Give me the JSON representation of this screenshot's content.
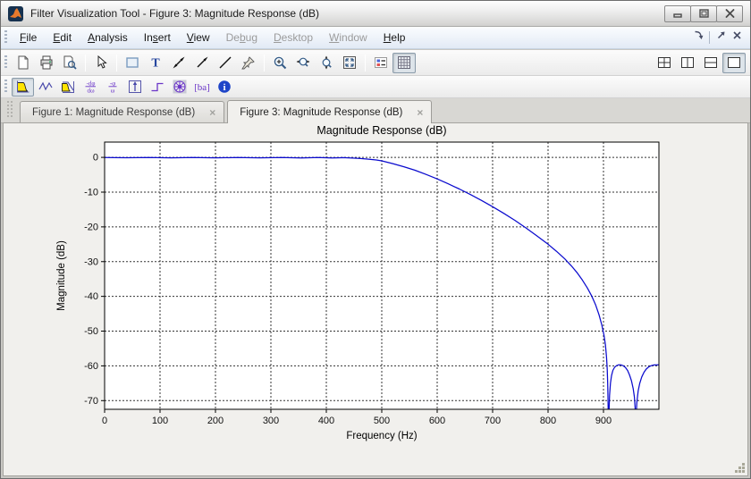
{
  "window": {
    "title": "Filter Visualization Tool - Figure 3: Magnitude Response (dB)",
    "controls": [
      {
        "name": "minimize-button",
        "icon": "minimize-icon"
      },
      {
        "name": "maximize-button",
        "icon": "maximize-icon"
      },
      {
        "name": "close-button",
        "icon": "close-icon"
      }
    ]
  },
  "menu_bar": {
    "items": [
      {
        "label": "File",
        "underline": 0,
        "enabled": true
      },
      {
        "label": "Edit",
        "underline": 0,
        "enabled": true
      },
      {
        "label": "Analysis",
        "underline": 0,
        "enabled": true
      },
      {
        "label": "Insert",
        "underline": 2,
        "enabled": true
      },
      {
        "label": "View",
        "underline": 0,
        "enabled": true
      },
      {
        "label": "Debug",
        "underline": 2,
        "enabled": false
      },
      {
        "label": "Desktop",
        "underline": 0,
        "enabled": false
      },
      {
        "label": "Window",
        "underline": 0,
        "enabled": false
      },
      {
        "label": "Help",
        "underline": 0,
        "enabled": true
      }
    ],
    "right_buttons": [
      {
        "name": "dock-figure-button",
        "icon": "dock-curved-arrow-icon"
      },
      {
        "name": "undock-figure-button",
        "icon": "undock-arrow-icon",
        "sep_before": true
      },
      {
        "name": "close-figure-button",
        "icon": "close-x-icon"
      }
    ]
  },
  "toolbar_main": {
    "left_buttons": [
      {
        "name": "new-session-button",
        "icon": "new-document-icon"
      },
      {
        "name": "print-button",
        "icon": "print-icon"
      },
      {
        "name": "print-preview-button",
        "icon": "print-preview-icon"
      },
      {
        "name": "edit-plot-button",
        "icon": "pointer-icon",
        "sep_before": true
      },
      {
        "name": "insert-rectangle-button",
        "icon": "rectangle-icon",
        "sep_before": true
      },
      {
        "name": "insert-text-button",
        "icon": "text-icon"
      },
      {
        "name": "insert-double-arrow-button",
        "icon": "double-arrow-icon"
      },
      {
        "name": "insert-arrow-button",
        "icon": "arrow-icon"
      },
      {
        "name": "insert-line-button",
        "icon": "line-icon"
      },
      {
        "name": "pin-to-axes-button",
        "icon": "pin-icon"
      },
      {
        "name": "zoom-in-button",
        "icon": "zoom-in-icon",
        "sep_before": true
      },
      {
        "name": "zoom-x-button",
        "icon": "zoom-x-icon"
      },
      {
        "name": "zoom-y-button",
        "icon": "zoom-y-icon"
      },
      {
        "name": "restore-view-button",
        "icon": "full-view-icon"
      },
      {
        "name": "toggle-legend-button",
        "icon": "legend-icon",
        "sep_before": true
      },
      {
        "name": "toggle-grid-button",
        "icon": "grid-icon",
        "pressed": true
      }
    ],
    "right_buttons": [
      {
        "name": "layout-quad-button",
        "icon": "layout-quad-icon"
      },
      {
        "name": "layout-vertical-button",
        "icon": "layout-vertical-icon"
      },
      {
        "name": "layout-horizontal-button",
        "icon": "layout-horizontal-icon"
      },
      {
        "name": "layout-single-button",
        "icon": "layout-single-icon",
        "pressed": true
      }
    ]
  },
  "toolbar_analysis": {
    "buttons": [
      {
        "name": "magnitude-response-button",
        "icon": "magnitude-icon",
        "pressed": true
      },
      {
        "name": "phase-response-button",
        "icon": "phase-icon"
      },
      {
        "name": "magnitude-and-phase-button",
        "icon": "mag-phase-icon"
      },
      {
        "name": "group-delay-button",
        "icon": "group-delay-icon"
      },
      {
        "name": "phase-delay-button",
        "icon": "phase-delay-icon"
      },
      {
        "name": "impulse-response-button",
        "icon": "impulse-icon"
      },
      {
        "name": "step-response-button",
        "icon": "step-icon"
      },
      {
        "name": "pole-zero-button",
        "icon": "pole-zero-icon"
      },
      {
        "name": "coefficients-button",
        "icon": "coefficients-icon"
      },
      {
        "name": "filter-info-button",
        "icon": "info-icon"
      }
    ]
  },
  "tab_bar": {
    "tabs": [
      {
        "label": "Figure 1: Magnitude Response (dB)",
        "active": false,
        "close_glyph": "×"
      },
      {
        "label": "Figure 3: Magnitude Response (dB)",
        "active": true,
        "close_glyph": "×"
      }
    ]
  },
  "chart_data": {
    "type": "line",
    "title": "Magnitude Response (dB)",
    "xlabel": "Frequency (Hz)",
    "ylabel": "Magnitude (dB)",
    "xlim": [
      0,
      1000
    ],
    "ylim": [
      -72.5,
      4.4
    ],
    "xticks": [
      0,
      100,
      200,
      300,
      400,
      500,
      600,
      700,
      800,
      900
    ],
    "yticks": [
      0,
      -10,
      -20,
      -30,
      -40,
      -50,
      -60,
      -70
    ],
    "grid": true,
    "legend_position": "none",
    "line_color": "#0b0bce",
    "axes_background": "#ffffff",
    "series": [
      {
        "name": "lowpass-filter-magnitude-response",
        "points": [
          [
            0,
            -0.03
          ],
          [
            40,
            -0.1
          ],
          [
            80,
            -0.03
          ],
          [
            120,
            -0.12
          ],
          [
            160,
            -0.04
          ],
          [
            200,
            -0.13
          ],
          [
            240,
            -0.04
          ],
          [
            280,
            -0.12
          ],
          [
            320,
            -0.05
          ],
          [
            355,
            -0.14
          ],
          [
            385,
            -0.06
          ],
          [
            410,
            -0.15
          ],
          [
            430,
            -0.08
          ],
          [
            448,
            -0.2
          ],
          [
            462,
            -0.32
          ],
          [
            476,
            -0.5
          ],
          [
            490,
            -0.75
          ],
          [
            500,
            -1.0
          ],
          [
            520,
            -1.8
          ],
          [
            540,
            -2.7
          ],
          [
            560,
            -3.7
          ],
          [
            580,
            -4.9
          ],
          [
            600,
            -6.2
          ],
          [
            620,
            -7.6
          ],
          [
            640,
            -9.1
          ],
          [
            660,
            -10.7
          ],
          [
            680,
            -12.4
          ],
          [
            700,
            -14.2
          ],
          [
            720,
            -16.1
          ],
          [
            740,
            -18.1
          ],
          [
            760,
            -20.3
          ],
          [
            780,
            -22.6
          ],
          [
            800,
            -25.0
          ],
          [
            815,
            -27.0
          ],
          [
            830,
            -29.2
          ],
          [
            842,
            -31.2
          ],
          [
            852,
            -33.1
          ],
          [
            862,
            -35.3
          ],
          [
            871,
            -37.6
          ],
          [
            879,
            -40.0
          ],
          [
            886,
            -42.5
          ],
          [
            892,
            -45.3
          ],
          [
            897,
            -48.2
          ],
          [
            901,
            -51.2
          ],
          [
            903.5,
            -54.0
          ],
          [
            905.5,
            -57.5
          ],
          [
            906.8,
            -61.0
          ],
          [
            907.6,
            -65.0
          ],
          [
            908.3,
            -70.0
          ],
          [
            909,
            -80
          ],
          [
            909.8,
            -74
          ],
          [
            911,
            -68.5
          ],
          [
            912.5,
            -65.0
          ],
          [
            914.5,
            -62.8
          ],
          [
            917,
            -61.3
          ],
          [
            920,
            -60.4
          ],
          [
            923.5,
            -59.95
          ],
          [
            927.5,
            -59.7
          ],
          [
            931.5,
            -59.72
          ],
          [
            935.5,
            -59.95
          ],
          [
            939.5,
            -60.45
          ],
          [
            943.5,
            -61.35
          ],
          [
            947,
            -62.6
          ],
          [
            950.5,
            -64.3
          ],
          [
            953.5,
            -66.5
          ],
          [
            955.8,
            -69.0
          ],
          [
            957.2,
            -72.5
          ],
          [
            958,
            -80
          ],
          [
            958.9,
            -74.5
          ],
          [
            960.2,
            -70.5
          ],
          [
            962.5,
            -67.2
          ],
          [
            965.5,
            -65.0
          ],
          [
            969,
            -63.2
          ],
          [
            973,
            -61.85
          ],
          [
            977,
            -60.95
          ],
          [
            981.5,
            -60.3
          ],
          [
            986,
            -59.95
          ],
          [
            991,
            -59.75
          ],
          [
            1000,
            -59.68
          ]
        ]
      }
    ]
  }
}
